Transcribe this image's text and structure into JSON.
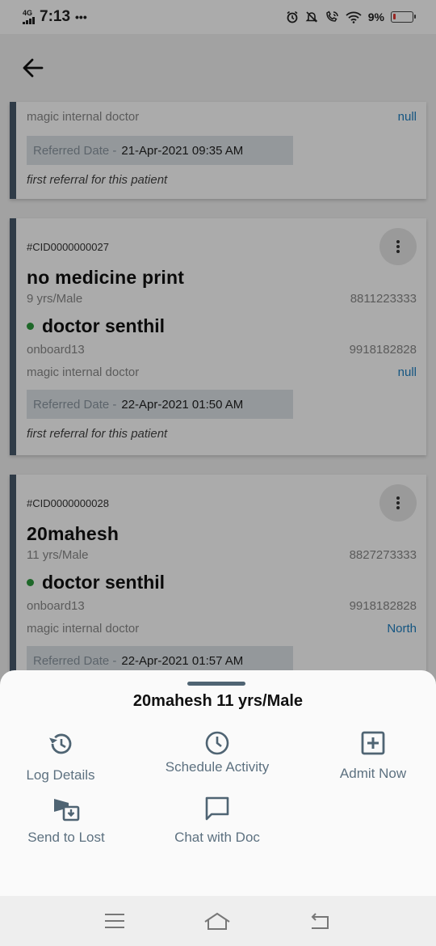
{
  "status_bar": {
    "network": "4G",
    "time": "7:13",
    "dots": "•••",
    "battery": "9%"
  },
  "icons": {
    "back": "back-arrow-icon",
    "more": "more-vert-icon",
    "log": "history-icon",
    "schedule": "clock-icon",
    "admit": "plus-box-icon",
    "lost": "send-to-lost-icon",
    "chat": "chat-bubble-icon"
  },
  "colors": {
    "card_accent": "#46596a",
    "link_blue": "#1e7fc1",
    "online_dot": "#2e9b3e",
    "action_gray": "#5d7180"
  },
  "cards": [
    {
      "doctor_type": "magic internal doctor",
      "area": "null",
      "referred_label": "Referred Date -",
      "referred_date": "21-Apr-2021 09:35 AM",
      "note": "first referral for this patient"
    },
    {
      "cid": "#CID0000000027",
      "patient_name": "no medicine print",
      "age_gender": "9 yrs/Male",
      "patient_phone": "8811223333",
      "doctor_name": "doctor senthil",
      "doctor_org": "onboard13",
      "doctor_phone": "9918182828",
      "doctor_type": "magic internal doctor",
      "area": "null",
      "referred_label": "Referred Date -",
      "referred_date": "22-Apr-2021 01:50 AM",
      "note": "first referral for this patient"
    },
    {
      "cid": "#CID0000000028",
      "patient_name": "20mahesh",
      "age_gender": "11 yrs/Male",
      "patient_phone": "8827273333",
      "doctor_name": "doctor senthil",
      "doctor_org": "onboard13",
      "doctor_phone": "9918182828",
      "doctor_type": "magic internal doctor",
      "area": "North",
      "referred_label": "Referred Date -",
      "referred_date": "22-Apr-2021 01:57 AM"
    }
  ],
  "sheet": {
    "title": "20mahesh 11 yrs/Male",
    "actions": {
      "log_details": "Log Details",
      "schedule_activity": "Schedule Activity",
      "admit_now": "Admit Now",
      "send_to_lost": "Send to Lost",
      "chat_with_doc": "Chat with Doc"
    }
  }
}
